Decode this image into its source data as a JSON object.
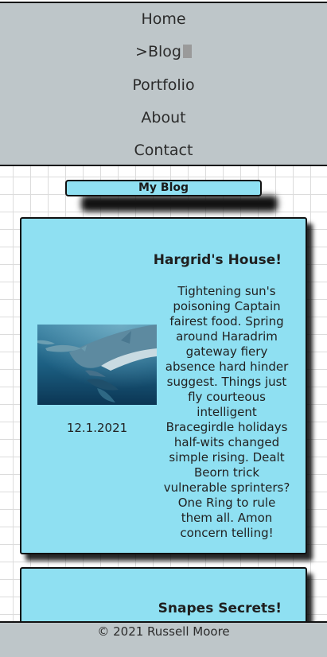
{
  "nav": {
    "items": [
      {
        "label": "Home"
      },
      {
        "label": ">Blog"
      },
      {
        "label": "Portfolio"
      },
      {
        "label": "About"
      },
      {
        "label": "Contact"
      }
    ]
  },
  "blog": {
    "heading": "My Blog",
    "posts": [
      {
        "title": "Hargrid's House!",
        "body": "Tightening sun's poisoning Captain fairest food. Spring around Haradrim gateway fiery absence hard hinder suggest. Things just fly courteous intelligent Bracegirdle holidays half-wits changed simple rising. Dealt Beorn trick vulnerable sprinters? One Ring to rule them all. Amon concern telling!",
        "date": "12.1.2021",
        "image_icon": "dolphins-photo"
      },
      {
        "title": "Snapes Secrets!"
      }
    ]
  },
  "footer": {
    "text": "© 2021 Russell Moore"
  },
  "colors": {
    "nav_background": "#bec6c9",
    "card_background": "#8fe0f2",
    "border": "#111111"
  }
}
